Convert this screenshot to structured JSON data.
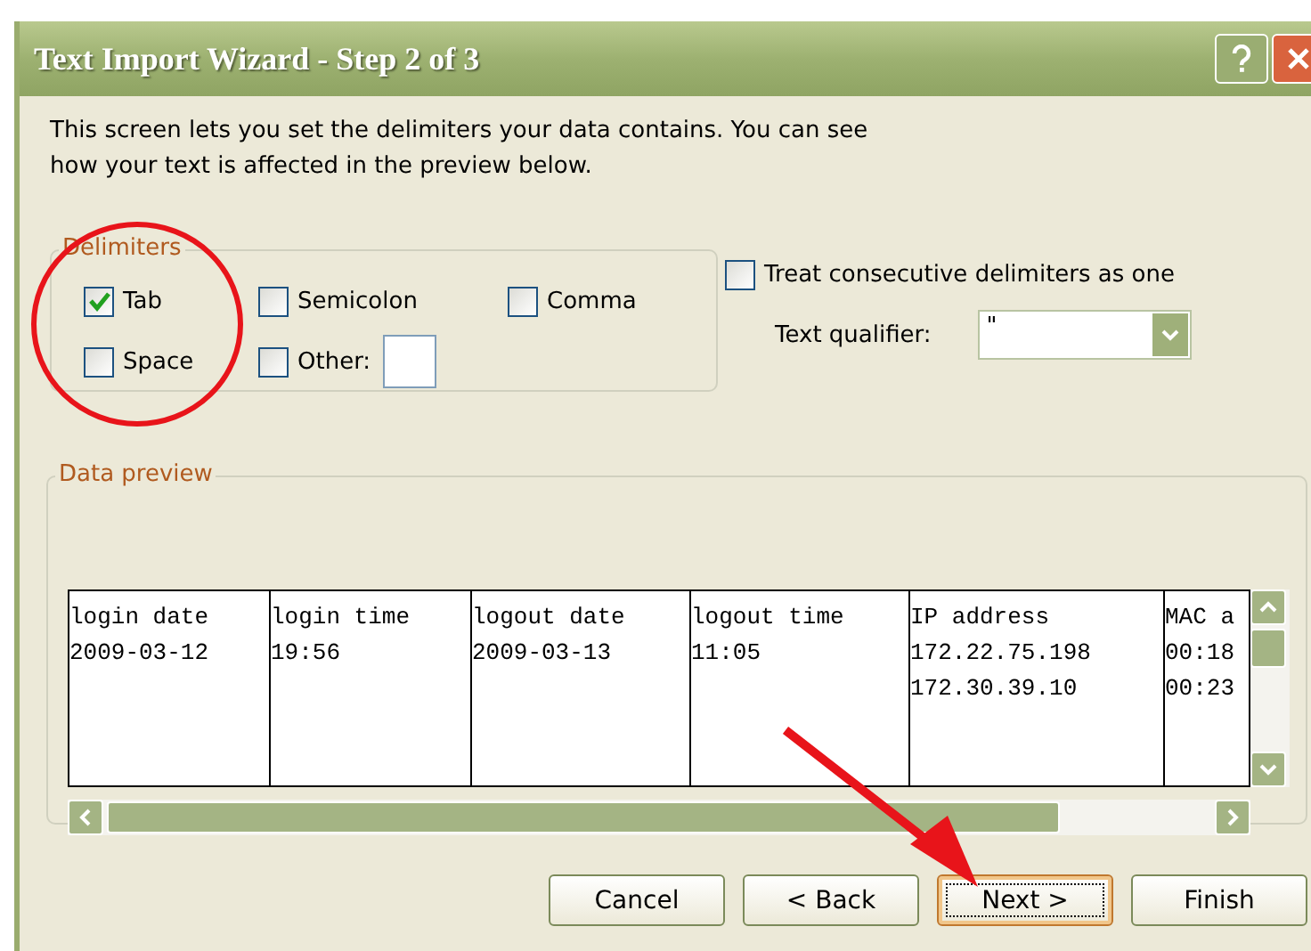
{
  "window": {
    "title": "Text Import Wizard - Step 2 of 3"
  },
  "intro": "This screen lets you set the delimiters your data contains.  You can see how your text is affected in the preview below.",
  "delimiters": {
    "label": "Delimiters",
    "options": [
      {
        "label": "Tab",
        "checked": true
      },
      {
        "label": "Semicolon",
        "checked": false
      },
      {
        "label": "Comma",
        "checked": false
      },
      {
        "label": "Space",
        "checked": false
      },
      {
        "label": "Other:",
        "checked": false,
        "has_field": true
      }
    ]
  },
  "treat_consecutive": {
    "label": "Treat consecutive delimiters as one",
    "checked": false
  },
  "text_qualifier": {
    "label": "Text qualifier:",
    "value": "\""
  },
  "preview": {
    "label": "Data preview",
    "columns": [
      {
        "lines": [
          "login date",
          "2009-03-12"
        ]
      },
      {
        "lines": [
          "login time",
          "19:56"
        ]
      },
      {
        "lines": [
          "logout date",
          "2009-03-13"
        ]
      },
      {
        "lines": [
          "logout time",
          "11:05"
        ]
      },
      {
        "lines": [
          "IP address",
          "172.22.75.198",
          "172.30.39.10"
        ]
      },
      {
        "lines": [
          "MAC a",
          "00:18",
          "00:23"
        ]
      }
    ]
  },
  "buttons": [
    {
      "label": "Cancel",
      "focused": false
    },
    {
      "label": "< Back",
      "focused": false
    },
    {
      "label": "Next >",
      "focused": true
    },
    {
      "label": "Finish",
      "focused": false
    }
  ]
}
